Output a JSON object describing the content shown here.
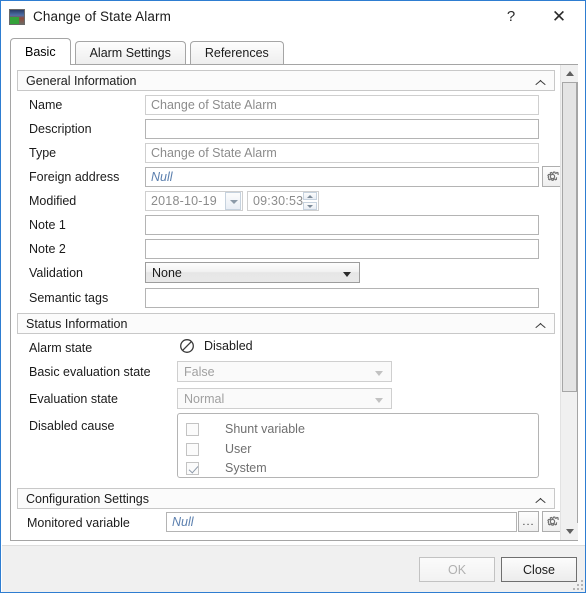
{
  "window": {
    "title": "Change of State Alarm",
    "icon": "app-thumbnail-icon",
    "help_label": "?",
    "close_label": "✕"
  },
  "tabs": [
    {
      "label": "Basic",
      "active": true
    },
    {
      "label": "Alarm Settings",
      "active": false
    },
    {
      "label": "References",
      "active": false
    }
  ],
  "groups": {
    "general": {
      "title": "General Information",
      "fields": {
        "name": {
          "label": "Name",
          "value": "Change of State Alarm",
          "disabled": true
        },
        "description": {
          "label": "Description",
          "value": "",
          "disabled": false
        },
        "type": {
          "label": "Type",
          "value": "Change of State Alarm",
          "disabled": true
        },
        "foreign_address": {
          "label": "Foreign address",
          "value": "Null",
          "disabled": false
        },
        "modified": {
          "label": "Modified",
          "date": "2018-10-19",
          "time": "09:30:53"
        },
        "note1": {
          "label": "Note 1",
          "value": ""
        },
        "note2": {
          "label": "Note 2",
          "value": ""
        },
        "validation": {
          "label": "Validation",
          "value": "None",
          "options": [
            "None"
          ]
        },
        "semantic_tags": {
          "label": "Semantic tags",
          "value": ""
        }
      }
    },
    "status": {
      "title": "Status Information",
      "fields": {
        "alarm_state": {
          "label": "Alarm state",
          "value": "Disabled",
          "icon": "prohibited-icon"
        },
        "basic_evaluation_state": {
          "label": "Basic evaluation state",
          "value": "False",
          "disabled": true
        },
        "evaluation_state": {
          "label": "Evaluation state",
          "value": "Normal",
          "disabled": true
        },
        "disabled_cause": {
          "label": "Disabled cause",
          "items": [
            {
              "label": "Shunt variable",
              "checked": false
            },
            {
              "label": "User",
              "checked": false
            },
            {
              "label": "System",
              "checked": true
            }
          ]
        }
      }
    },
    "configuration": {
      "title": "Configuration Settings",
      "fields": {
        "monitored_variable": {
          "label": "Monitored variable",
          "value": "Null",
          "browse_label": "...",
          "settings_icon": "gear-icon"
        }
      }
    }
  },
  "footer": {
    "ok_label": "OK",
    "ok_enabled": false,
    "close_label": "Close",
    "close_enabled": true
  },
  "colors": {
    "window_border": "#2e7dd1",
    "null_text": "#5b7fae",
    "disabled_text": "#8c8c8c",
    "footer_bg": "#f0f0f0"
  }
}
